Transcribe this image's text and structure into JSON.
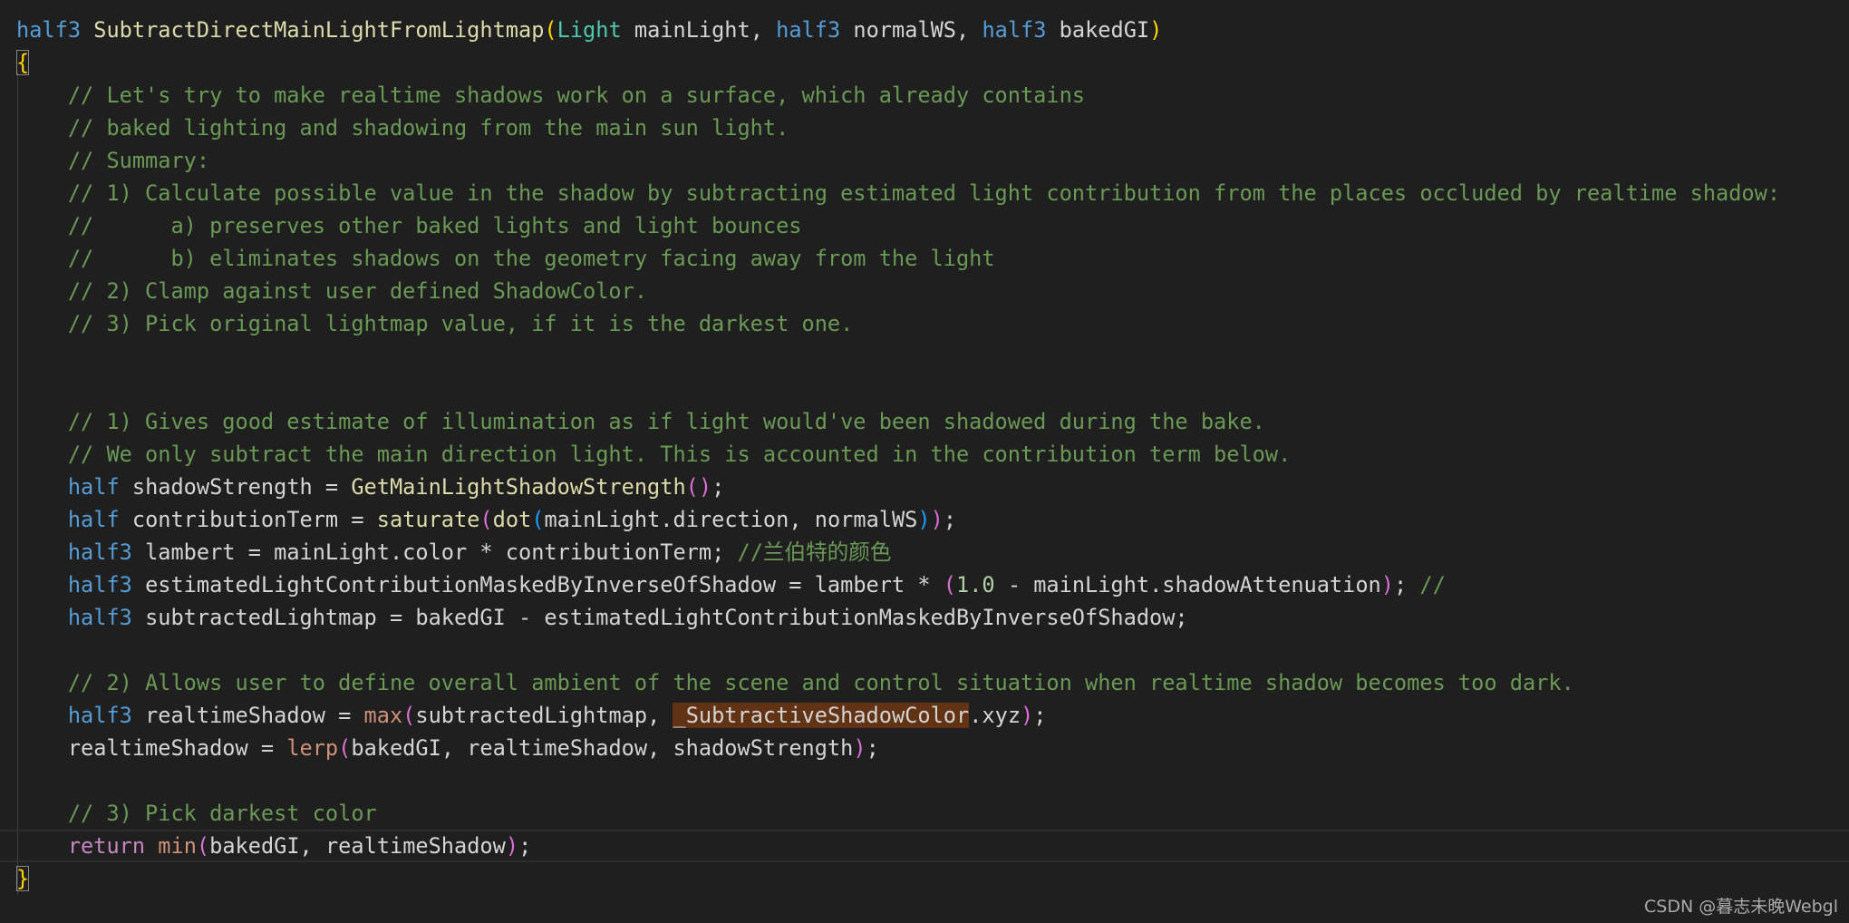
{
  "lines": [
    [
      [
        "half3",
        "t-kw"
      ],
      [
        " ",
        "t-id"
      ],
      [
        "SubtractDirectMainLightFromLightmap",
        "t-fn"
      ],
      [
        "(",
        "b1"
      ],
      [
        "Light",
        "t-type"
      ],
      [
        " mainLight, ",
        "t-id"
      ],
      [
        "half3",
        "t-kw"
      ],
      [
        " normalWS, ",
        "t-id"
      ],
      [
        "half3",
        "t-kw"
      ],
      [
        " bakedGI",
        "t-id"
      ],
      [
        ")",
        "b1"
      ]
    ],
    [
      [
        "{",
        "b1 brace-hl"
      ]
    ],
    [
      [
        "    ",
        "t-id"
      ],
      [
        "// Let's try to make realtime shadows work on a surface, which already contains",
        "t-cm"
      ]
    ],
    [
      [
        "    ",
        "t-id"
      ],
      [
        "// baked lighting and shadowing from the main sun light.",
        "t-cm"
      ]
    ],
    [
      [
        "    ",
        "t-id"
      ],
      [
        "// Summary:",
        "t-cm"
      ]
    ],
    [
      [
        "    ",
        "t-id"
      ],
      [
        "// 1) Calculate possible value in the shadow by subtracting estimated light contribution from the places occluded by realtime shadow:",
        "t-cm"
      ]
    ],
    [
      [
        "    ",
        "t-id"
      ],
      [
        "//      a) preserves other baked lights and light bounces",
        "t-cm"
      ]
    ],
    [
      [
        "    ",
        "t-id"
      ],
      [
        "//      b) eliminates shadows on the geometry facing away from the light",
        "t-cm"
      ]
    ],
    [
      [
        "    ",
        "t-id"
      ],
      [
        "// 2) Clamp against user defined ShadowColor.",
        "t-cm"
      ]
    ],
    [
      [
        "    ",
        "t-id"
      ],
      [
        "// 3) Pick original lightmap value, if it is the darkest one.",
        "t-cm"
      ]
    ],
    [],
    [],
    [
      [
        "    ",
        "t-id"
      ],
      [
        "// 1) Gives good estimate of illumination as if light would've been shadowed during the bake.",
        "t-cm"
      ]
    ],
    [
      [
        "    ",
        "t-id"
      ],
      [
        "// We only subtract the main direction light. This is accounted in the contribution term below.",
        "t-cm"
      ]
    ],
    [
      [
        "    ",
        "t-id"
      ],
      [
        "half",
        "t-kw"
      ],
      [
        " shadowStrength = ",
        "t-id"
      ],
      [
        "GetMainLightShadowStrength",
        "t-fn"
      ],
      [
        "()",
        "b2"
      ],
      [
        ";",
        "t-id"
      ]
    ],
    [
      [
        "    ",
        "t-id"
      ],
      [
        "half",
        "t-kw"
      ],
      [
        " contributionTerm = ",
        "t-id"
      ],
      [
        "saturate",
        "t-fn"
      ],
      [
        "(",
        "b2"
      ],
      [
        "dot",
        "t-fn"
      ],
      [
        "(",
        "b3"
      ],
      [
        "mainLight.direction, normalWS",
        "t-id"
      ],
      [
        ")",
        "b3"
      ],
      [
        ")",
        "b2"
      ],
      [
        ";",
        "t-id"
      ]
    ],
    [
      [
        "    ",
        "t-id"
      ],
      [
        "half3",
        "t-kw"
      ],
      [
        " lambert = mainLight.color * contributionTerm; ",
        "t-id"
      ],
      [
        "//兰伯特的颜色",
        "t-cm"
      ]
    ],
    [
      [
        "    ",
        "t-id"
      ],
      [
        "half3",
        "t-kw"
      ],
      [
        " estimatedLightContributionMaskedByInverseOfShadow = lambert * ",
        "t-id"
      ],
      [
        "(",
        "b2"
      ],
      [
        "1.0",
        "t-num"
      ],
      [
        " - mainLight.shadowAttenuation",
        "t-id"
      ],
      [
        ")",
        "b2"
      ],
      [
        "; ",
        "t-id"
      ],
      [
        "//",
        "t-cm"
      ]
    ],
    [
      [
        "    ",
        "t-id"
      ],
      [
        "half3",
        "t-kw"
      ],
      [
        " subtractedLightmap = bakedGI - estimatedLightContributionMaskedByInverseOfShadow;",
        "t-id"
      ]
    ],
    [],
    [
      [
        "    ",
        "t-id"
      ],
      [
        "// 2) Allows user to define overall ambient of the scene and control situation when realtime shadow becomes too dark.",
        "t-cm"
      ]
    ],
    [
      [
        "    ",
        "t-id"
      ],
      [
        "half3",
        "t-kw"
      ],
      [
        " realtimeShadow = ",
        "t-id"
      ],
      [
        "max",
        "t-bi"
      ],
      [
        "(",
        "b2"
      ],
      [
        "subtractedLightmap, ",
        "t-id"
      ],
      [
        "_SubtractiveShadowColor",
        "t-id t-hl"
      ],
      [
        ".xyz",
        "t-id"
      ],
      [
        ")",
        "b2"
      ],
      [
        ";",
        "t-id"
      ]
    ],
    [
      [
        "    ",
        "t-id"
      ],
      [
        "realtimeShadow = ",
        "t-id"
      ],
      [
        "lerp",
        "t-bi"
      ],
      [
        "(",
        "b2"
      ],
      [
        "bakedGI, realtimeShadow, shadowStrength",
        "t-id"
      ],
      [
        ")",
        "b2"
      ],
      [
        ";",
        "t-id"
      ]
    ],
    [],
    [
      [
        "    ",
        "t-id"
      ],
      [
        "// 3) Pick darkest color",
        "t-cm"
      ]
    ],
    [
      [
        "    ",
        "t-id"
      ],
      [
        "return",
        "t-ret"
      ],
      [
        " ",
        "t-id"
      ],
      [
        "min",
        "t-bi"
      ],
      [
        "(",
        "b2"
      ],
      [
        "bakedGI, realtimeShadow",
        "t-id"
      ],
      [
        ")",
        "b2"
      ],
      [
        ";",
        "t-id"
      ]
    ],
    [
      [
        "}",
        "b1 brace-hl"
      ]
    ]
  ],
  "current_line": 25,
  "watermark": "CSDN @暮志未晚Webgl"
}
